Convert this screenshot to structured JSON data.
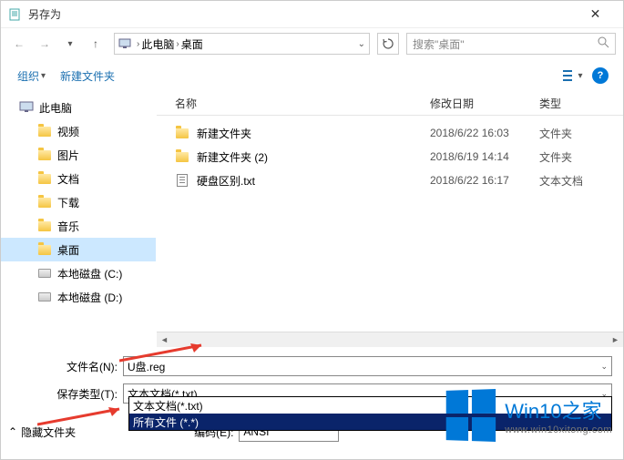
{
  "window": {
    "title": "另存为"
  },
  "nav": {
    "crumb1": "此电脑",
    "crumb2": "桌面",
    "search_placeholder": "搜索\"桌面\""
  },
  "toolbar": {
    "organize": "组织",
    "newfolder": "新建文件夹"
  },
  "sidebar": {
    "items": [
      {
        "label": "此电脑",
        "icon": "pc"
      },
      {
        "label": "视频",
        "icon": "folder"
      },
      {
        "label": "图片",
        "icon": "folder"
      },
      {
        "label": "文档",
        "icon": "folder"
      },
      {
        "label": "下载",
        "icon": "folder"
      },
      {
        "label": "音乐",
        "icon": "folder"
      },
      {
        "label": "桌面",
        "icon": "folder",
        "selected": true
      },
      {
        "label": "本地磁盘 (C:)",
        "icon": "disk"
      },
      {
        "label": "本地磁盘 (D:)",
        "icon": "disk"
      }
    ]
  },
  "columns": {
    "name": "名称",
    "date": "修改日期",
    "type": "类型"
  },
  "files": [
    {
      "name": "新建文件夹",
      "date": "2018/6/22 16:03",
      "type": "文件夹",
      "icon": "folder"
    },
    {
      "name": "新建文件夹 (2)",
      "date": "2018/6/19 14:14",
      "type": "文件夹",
      "icon": "folder"
    },
    {
      "name": "硬盘区别.txt",
      "date": "2018/6/22 16:17",
      "type": "文本文档",
      "icon": "txt"
    }
  ],
  "form": {
    "filename_label": "文件名(N):",
    "filename_value": "U盘.reg",
    "type_label": "保存类型(T):",
    "type_value": "文本文档(*.txt)",
    "options": [
      {
        "label": "文本文档(*.txt)"
      },
      {
        "label": "所有文件 (*.*)",
        "selected": true
      }
    ],
    "encoding_label": "编码(E):",
    "encoding_value": "ANSI",
    "hide_folders": "隐藏文件夹"
  },
  "watermark": {
    "brand": "Win10",
    "suffix": "之家",
    "url": "www.win10xitong.com"
  }
}
